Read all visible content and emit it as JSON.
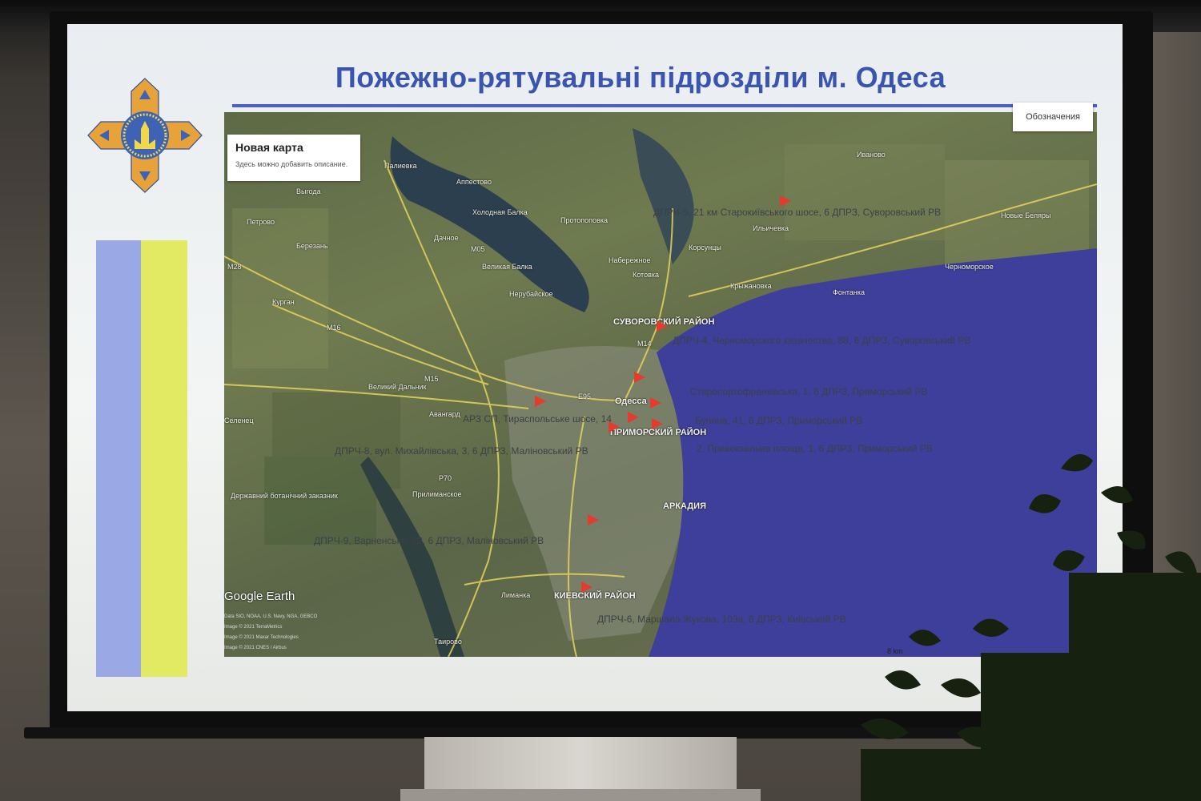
{
  "slide": {
    "title": "Пожежно-рятувальні підрозділи м. Одеса"
  },
  "map_panel": {
    "card_title": "Новая карта",
    "card_description": "Здесь можно добавить описание.",
    "legend_button": "Обозначения",
    "brand": "Google Earth",
    "credits": [
      "Data SIO, NOAA, U.S. Navy, NGA, GEBCO",
      "Image © 2021 TerraMetrics",
      "Image © 2021 Maxar Technologies",
      "Image © 2021 CNES / Airbus"
    ],
    "scale_text": "8 km"
  },
  "place_labels": [
    "Аппестово",
    "Палиевка",
    "Выгода",
    "Холодная Балка",
    "Протопоповка",
    "Петрово",
    "Дачное",
    "Березань",
    "Великая Балка",
    "Набережное",
    "Котовка",
    "Корсунцы",
    "Нерубайское",
    "Курган",
    "Крыжановка",
    "Фонтанка",
    "Черноморское",
    "Новые Беляры",
    "Ильичевка",
    "Иваново",
    "Великий Дальник",
    "Авангард",
    "Одесса",
    "Прилиманское",
    "Лиманка",
    "Таирово",
    "Державний ботанічний заказник",
    "Селенец"
  ],
  "district_labels": [
    "СУВОРОВСКИЙ РАЙОН",
    "ПРИМОРСКИЙ РАЙОН",
    "АРКАДИЯ",
    "КИЕВСКИЙ РАЙОН"
  ],
  "road_labels": [
    "M16",
    "M15",
    "M14",
    "M05",
    "P70",
    "E95",
    "M28"
  ],
  "stations": [
    "ДПРЧ-5, 21 км Старокиївського шосе, 6 ДПРЗ, Суворовський РВ",
    "ДПРЧ-4, Черноморского казачества, 88, 6 ДПРЗ, Суворовський РВ",
    "Старопортофранківська, 1, 6 ДПРЗ, Приморський РВ",
    "АРЗ СП, Тираспольське шосе, 14",
    "Бунина, 41, 6 ДПРЗ, Приморський РВ",
    "ДПРЧ-8, вул. Михайлівська, 3, 6 ДПРЗ, Маліновський РВ",
    "2, Привокзальна площа, 1, 6 ДПРЗ, Приморський РВ",
    "ДПРЧ-9, Варненська, 22, 6 ДПРЗ, Маліновський РВ",
    "ДПРЧ-6, Маршала Жукова, 103а, 6 ДПРЗ, Київський РВ"
  ],
  "colors": {
    "title_blue": "#3a55b0",
    "flag_blue": "#9aa8e6",
    "flag_yellow": "#e1ea62",
    "marker_red": "#e53b2e",
    "sea": "#3d3f9a",
    "emblem_orange": "#e8a23a"
  },
  "icons": {
    "emblem": "dsns-cross-trident-emblem",
    "markers": "red-triangle-marker"
  }
}
